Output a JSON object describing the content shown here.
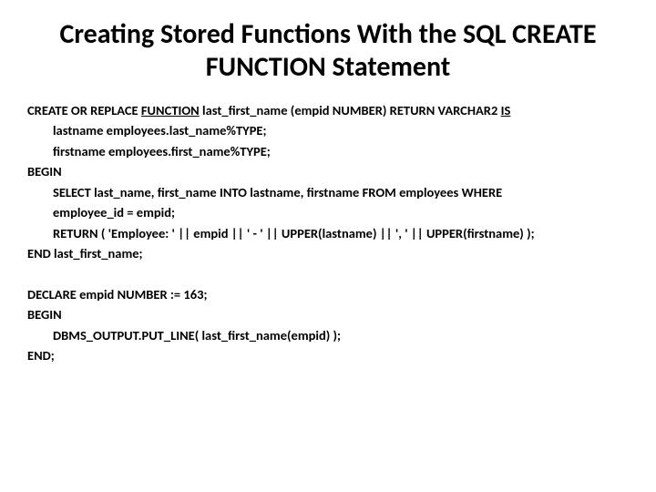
{
  "title": "Creating Stored Functions With the SQL CREATE FUNCTION Statement",
  "b1": {
    "l1a": "CREATE OR REPLACE ",
    "l1b": "FUNCTION",
    "l1c": " last_first_name (empid NUMBER) RETURN VARCHAR2 ",
    "l1d": "IS",
    "l2": "lastname employees.last_name%TYPE;",
    "l3": "firstname employees.first_name%TYPE;",
    "l4": "BEGIN",
    "l5": "SELECT last_name, first_name INTO lastname, firstname FROM employees WHERE",
    "l6": "employee_id = empid;",
    "l7": "RETURN ( 'Employee: ' || empid || ' - ' || UPPER(lastname) || ', ' || UPPER(firstname) );",
    "l8": "END last_first_name;"
  },
  "b2": {
    "l1": "DECLARE empid NUMBER := 163;",
    "l2": "BEGIN",
    "l3": "DBMS_OUTPUT.PUT_LINE( last_first_name(empid) );",
    "l4": "END;"
  }
}
